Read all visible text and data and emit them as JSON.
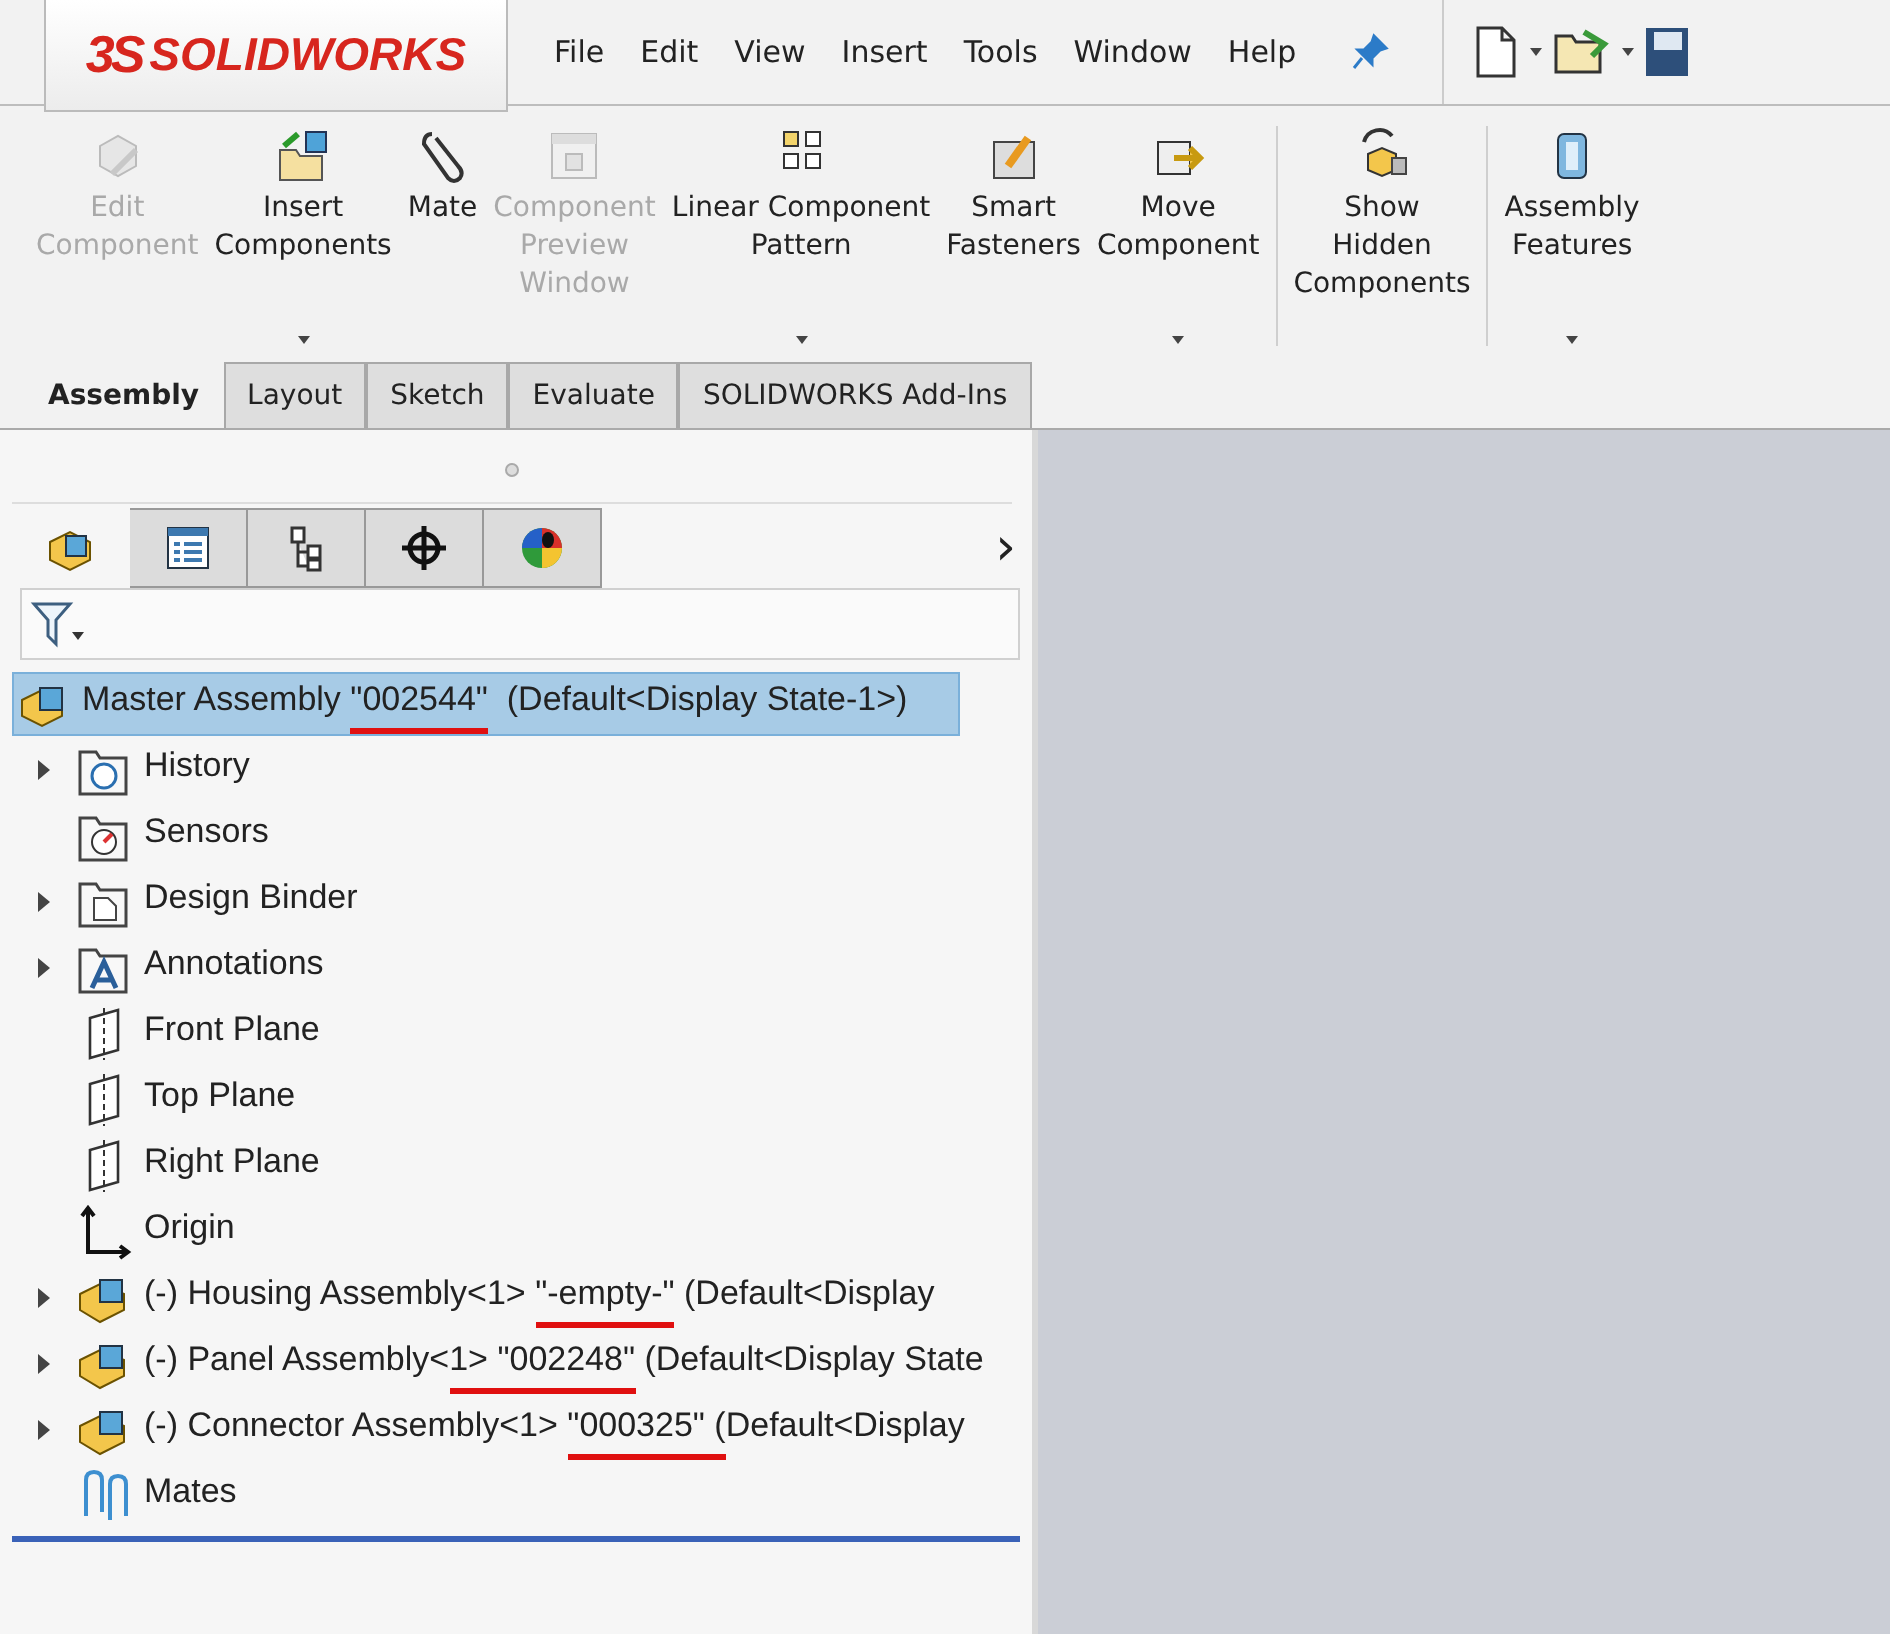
{
  "logo": {
    "mark": "3S",
    "text": "SOLIDWORKS"
  },
  "menu": [
    "File",
    "Edit",
    "View",
    "Insert",
    "Tools",
    "Window",
    "Help"
  ],
  "ribbon": [
    {
      "label": "Edit\nComponent",
      "kind": "edit",
      "disabled": true,
      "dropdown": false
    },
    {
      "label": "Insert\nComponents",
      "kind": "insert",
      "disabled": false,
      "dropdown": true
    },
    {
      "label": "Mate",
      "kind": "mate",
      "disabled": false,
      "dropdown": false
    },
    {
      "label": "Component\nPreview\nWindow",
      "kind": "preview",
      "disabled": true,
      "dropdown": false
    },
    {
      "label": "Linear Component\nPattern",
      "kind": "pattern",
      "disabled": false,
      "dropdown": true
    },
    {
      "label": "Smart\nFasteners",
      "kind": "fastener",
      "disabled": false,
      "dropdown": false
    },
    {
      "label": "Move\nComponent",
      "kind": "move",
      "disabled": false,
      "dropdown": true
    },
    {
      "label": "Show\nHidden\nComponents",
      "kind": "show",
      "disabled": false,
      "dropdown": false,
      "separator_before": true
    },
    {
      "label": "Assembly\nFeatures",
      "kind": "features",
      "disabled": false,
      "dropdown": true,
      "separator_before": true
    }
  ],
  "tabs": [
    {
      "label": "Assembly",
      "selected": true
    },
    {
      "label": "Layout",
      "selected": false
    },
    {
      "label": "Sketch",
      "selected": false
    },
    {
      "label": "Evaluate",
      "selected": false
    },
    {
      "label": "SOLIDWORKS Add-Ins",
      "selected": false
    }
  ],
  "panel_tabs": [
    {
      "kind": "feature-tree",
      "selected": true
    },
    {
      "kind": "property",
      "selected": false
    },
    {
      "kind": "config",
      "selected": false
    },
    {
      "kind": "dimxpert",
      "selected": false
    },
    {
      "kind": "appearance",
      "selected": false
    }
  ],
  "panel_more": "›",
  "tree": {
    "kind": "assembly",
    "selected": true,
    "label": [
      {
        "text": "Master Assembly ",
        "marked": false
      },
      {
        "text": "\"002544\"",
        "marked": true
      },
      {
        "text": "  (Default<Display State-1>)",
        "marked": false
      }
    ],
    "children": [
      {
        "kind": "history",
        "has_children": true,
        "label": [
          {
            "text": "History",
            "marked": false
          }
        ]
      },
      {
        "kind": "sensors",
        "has_children": false,
        "label": [
          {
            "text": "Sensors",
            "marked": false
          }
        ]
      },
      {
        "kind": "binder",
        "has_children": true,
        "label": [
          {
            "text": "Design Binder",
            "marked": false
          }
        ]
      },
      {
        "kind": "annotations",
        "has_children": true,
        "label": [
          {
            "text": "Annotations",
            "marked": false
          }
        ]
      },
      {
        "kind": "plane",
        "has_children": false,
        "label": [
          {
            "text": "Front Plane",
            "marked": false
          }
        ]
      },
      {
        "kind": "plane",
        "has_children": false,
        "label": [
          {
            "text": "Top Plane",
            "marked": false
          }
        ]
      },
      {
        "kind": "plane",
        "has_children": false,
        "label": [
          {
            "text": "Right Plane",
            "marked": false
          }
        ]
      },
      {
        "kind": "origin",
        "has_children": false,
        "label": [
          {
            "text": "Origin",
            "marked": false
          }
        ]
      },
      {
        "kind": "assembly",
        "has_children": true,
        "label": [
          {
            "text": "(-) Housing Assembly<1> ",
            "marked": false
          },
          {
            "text": "\"-empty-\"",
            "marked": true
          },
          {
            "text": " (Default<Display",
            "marked": false
          }
        ]
      },
      {
        "kind": "assembly",
        "has_children": true,
        "label": [
          {
            "text": "(-) Panel Assembly<",
            "marked": false
          },
          {
            "text": "1> \"002248\"",
            "marked": true
          },
          {
            "text": " (Default<Display State",
            "marked": false
          }
        ]
      },
      {
        "kind": "assembly",
        "has_children": true,
        "label": [
          {
            "text": "(-) Connector Assembly<1> ",
            "marked": false
          },
          {
            "text": "\"000325\" (",
            "marked": true
          },
          {
            "text": "Default<Display",
            "marked": false
          }
        ]
      },
      {
        "kind": "mates",
        "has_children": false,
        "label": [
          {
            "text": "Mates",
            "marked": false
          }
        ]
      }
    ]
  }
}
